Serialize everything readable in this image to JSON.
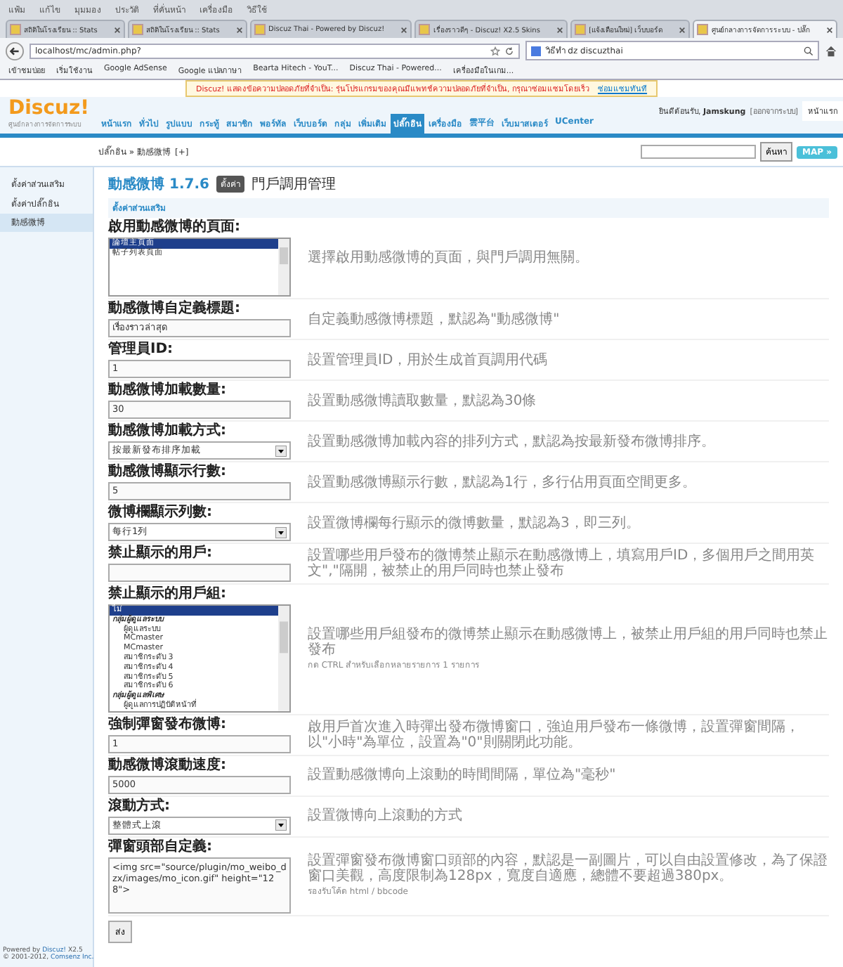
{
  "browser": {
    "menu": [
      "แฟ้ม",
      "แก้ไข",
      "มุมมอง",
      "ประวัติ",
      "ที่คั่นหน้า",
      "เครื่องมือ",
      "วิธีใช้"
    ],
    "tabs": [
      {
        "title": "สถิติในโรงเรียน :: Stats",
        "selected": false
      },
      {
        "title": "สถิติในโรงเรียน :: Stats",
        "selected": false
      },
      {
        "title": "Discuz Thai - Powered by Discuz!",
        "selected": false
      },
      {
        "title": "เรื่องราวดีๆ - Discuz! X2.5 Skins",
        "selected": false
      },
      {
        "title": "[แจ้งเตือนใหม่] เว็บบอร์ด",
        "selected": false
      },
      {
        "title": "ศูนย์กลางการจัดการระบบ - ปลั๊ก",
        "selected": true
      }
    ],
    "url": "localhost/mc/admin.php?",
    "search": "วิธีทำ dz discuzthai",
    "bookmarks": [
      "เข้าชมบ่อย",
      "เริ่มใช้งาน",
      "Google AdSense",
      "Google แปลภาษา",
      "Bearta Hitech - YouT...",
      "Discuz Thai - Powered...",
      "เครื่องมือในเกม..."
    ]
  },
  "notice": {
    "text": "Discuz! แสดงข้อความปลอดภัยที่จำเป็น: รุ่นโปรแกรมของคุณมีแพทช์ความปลอดภัยที่จำเป็น, กรุณาซ่อมแซมโดยเร็ว",
    "link": "ซ่อมแซมทันที"
  },
  "header": {
    "logo": "Discuz!",
    "subtitle": "ศูนย์กลางการจัดการระบบ",
    "welcome": "ยินดีต้อนรับ, ",
    "user": "Jamskung",
    "logout": "[ออกจากระบบ]",
    "home": "หน้าแรก",
    "nav": [
      {
        "label": "หน้าแรก",
        "selected": false
      },
      {
        "label": "ทั่วไป",
        "selected": false
      },
      {
        "label": "รูปแบบ",
        "selected": false
      },
      {
        "label": "กระทู้",
        "selected": false
      },
      {
        "label": "สมาชิก",
        "selected": false
      },
      {
        "label": "พอร์ทัล",
        "selected": false
      },
      {
        "label": "เว็บบอร์ด",
        "selected": false
      },
      {
        "label": "กลุ่ม",
        "selected": false
      },
      {
        "label": "เพิ่มเติม",
        "selected": false
      },
      {
        "label": "ปลั๊กอิน",
        "selected": true
      },
      {
        "label": "เครื่องมือ",
        "selected": false
      },
      {
        "label": "雲平台",
        "selected": false
      },
      {
        "label": "เว็บมาสเตอร์",
        "selected": false
      },
      {
        "label": "UCenter",
        "selected": false
      }
    ]
  },
  "breadcrumb": {
    "path": "ปลั๊กอิน » 動感微博",
    "add": "[+]",
    "search_button": "ค้นหา",
    "map": "MAP »"
  },
  "sidebar": {
    "items": [
      {
        "label": "ตั้งค่าส่วนเสริม",
        "selected": false
      },
      {
        "label": "ตั้งค่าปลั๊กอิน",
        "selected": false
      },
      {
        "label": "動感微博",
        "selected": true
      }
    ],
    "footer": {
      "powered": "Powered by ",
      "brand": "Discuz!",
      "version": " X2.5",
      "copyright": "© 2001-2012, ",
      "company": "Comsenz Inc."
    }
  },
  "plugin": {
    "title": "動感微博 1.7.6",
    "badge": "ตั้งค่า",
    "link": "門戶調用管理",
    "section": "ตั้งค่าส่วนเสริม",
    "fields": [
      {
        "kind": "listbox",
        "label": "啟用動感微博的頁面:",
        "options": [
          {
            "label": "論壇主頁面",
            "selected": true
          },
          {
            "label": "帖子列表頁面",
            "selected": false
          }
        ],
        "description": "選擇啟用動感微博的頁面，與門戶調用無關。"
      },
      {
        "kind": "text",
        "label": "動感微博自定義標題:",
        "value": "เรื่องราวล่าสุด",
        "description": "自定義動感微博標題，默認為\"動感微博\""
      },
      {
        "kind": "text",
        "label": "管理員ID:",
        "value": "1",
        "description": "設置管理員ID，用於生成首頁調用代碼"
      },
      {
        "kind": "text",
        "label": "動感微博加載數量:",
        "value": "30",
        "description": "設置動感微博讀取數量，默認為30條"
      },
      {
        "kind": "select",
        "label": "動感微博加載方式:",
        "value": "按最新發布排序加載",
        "description": "設置動感微博加載內容的排列方式，默認為按最新發布微博排序。"
      },
      {
        "kind": "text",
        "label": "動感微博顯示行數:",
        "value": "5",
        "description": "設置動感微博顯示行數，默認為1行，多行佔用頁面空間更多。"
      },
      {
        "kind": "select",
        "label": "微博欄顯示列數:",
        "value": "每行1列",
        "description": "設置微博欄每行顯示的微博數量，默認為3，即三列。"
      },
      {
        "kind": "text",
        "label": "禁止顯示的用戶:",
        "description": "設置哪些用戶發布的微博禁止顯示在動感微博上，填寫用戶ID，多個用戶之間用英文\",\"隔開，被禁止的用戶同時也禁止發布"
      },
      {
        "kind": "multilist",
        "label": "禁止顯示的用戶組:",
        "options": [
          {
            "kind": "option",
            "label": "ไม่",
            "selected": true
          },
          {
            "kind": "group",
            "label": "กลุ่มผู้ดูแลระบบ",
            "selected": false,
            "children": [
              {
                "label": "ผู้ดูแลระบบ",
                "selected": false
              },
              {
                "label": "MCmaster",
                "selected": false
              },
              {
                "label": "MCmaster",
                "selected": false
              },
              {
                "label": "สมาชิกระดับ 3",
                "selected": false
              },
              {
                "label": "สมาชิกระดับ 4",
                "selected": false
              },
              {
                "label": "สมาชิกระดับ 5",
                "selected": false
              },
              {
                "label": "สมาชิกระดับ 6",
                "selected": false
              }
            ]
          },
          {
            "kind": "group",
            "label": "กลุ่มผู้ดูแลพิเศษ",
            "selected": false,
            "children": [
              {
                "label": "ผู้ดูแลการปฏิบัติหน้าที่",
                "selected": false
              }
            ]
          }
        ],
        "description": "設置哪些用戶組發布的微博禁止顯示在動感微博上，被禁止用戶組的用戶同時也禁止發布",
        "hint": "กด CTRL สำหรับเลือกหลายรายการ 1 รายการ"
      },
      {
        "kind": "text",
        "label": "強制彈窗發布微博:",
        "value": "1",
        "description": "啟用戶首次進入時彈出發布微博窗口，強迫用戶發布一條微博，設置彈窗間隔，以\"小時\"為單位，設置為\"0\"則關閉此功能。"
      },
      {
        "kind": "text",
        "label": "動感微博滾動速度:",
        "value": "5000",
        "description": "設置動感微博向上滾動的時間間隔，單位為\"毫秒\""
      },
      {
        "kind": "select",
        "label": "滾動方式:",
        "value": "整體式上滾",
        "description": "設置微博向上滾動的方式"
      },
      {
        "kind": "textarea",
        "label": "彈窗頭部自定義:",
        "value": "<img src=\"source/plugin/mo_weibo_dzx/images/mo_icon.gif\" height=\"128\">",
        "description": "設置彈窗發布微博窗口頭部的內容，默認是一副圖片，可以自由設置修改，為了保證窗口美觀，高度限制為128px，寬度自適應，總體不要超過380px。",
        "hint": "รองรับโค้ด html / bbcode"
      }
    ],
    "submit": "ส่ง"
  }
}
